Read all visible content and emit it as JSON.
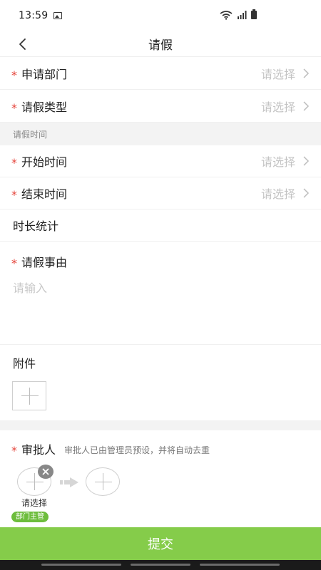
{
  "status_bar": {
    "time": "13:59"
  },
  "nav": {
    "title": "请假"
  },
  "form": {
    "required_mark": "*",
    "department": {
      "label": "申请部门",
      "placeholder": "请选择"
    },
    "leave_type": {
      "label": "请假类型",
      "placeholder": "请选择"
    },
    "time_section": "请假时间",
    "start_time": {
      "label": "开始时间",
      "placeholder": "请选择"
    },
    "end_time": {
      "label": "结束时间",
      "placeholder": "请选择"
    },
    "duration": {
      "label": "时长统计"
    },
    "reason": {
      "label": "请假事由",
      "placeholder": "请输入"
    },
    "attachment": {
      "label": "附件"
    }
  },
  "approver": {
    "label": "审批人",
    "hint": "审批人已由管理员预设，并将自动去重",
    "first": {
      "name": "请选择",
      "role": "部门主管"
    }
  },
  "submit_label": "提交",
  "colors": {
    "accent": "#85cc4a",
    "required": "#e5443b",
    "tag": "#6dbd3c"
  }
}
